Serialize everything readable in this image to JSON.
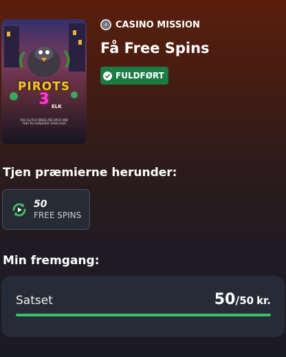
{
  "game": {
    "logo_text": "PIROTS",
    "logo_number": "3",
    "brand": "ELK",
    "tagline": "THE CLUTCH BIRDS ARE BACK AND THEY'RE HUNGRIER THAN EVER"
  },
  "mission": {
    "category_label": "CASINO MISSION",
    "title": "Få Free Spins",
    "status_label": "FULDFØRT",
    "status_color": "#1c7a43"
  },
  "rewards": {
    "heading": "Tjen præmierne herunder:",
    "items": [
      {
        "amount": "50",
        "type": "FREE SPINS",
        "icon": "free-spins-icon"
      }
    ]
  },
  "progress": {
    "heading": "Min fremgang:",
    "label": "Satset",
    "current": "50",
    "slash": "/",
    "target": "50",
    "unit": "kr.",
    "fraction": 1.0,
    "fill_color": "#3fbd67"
  }
}
